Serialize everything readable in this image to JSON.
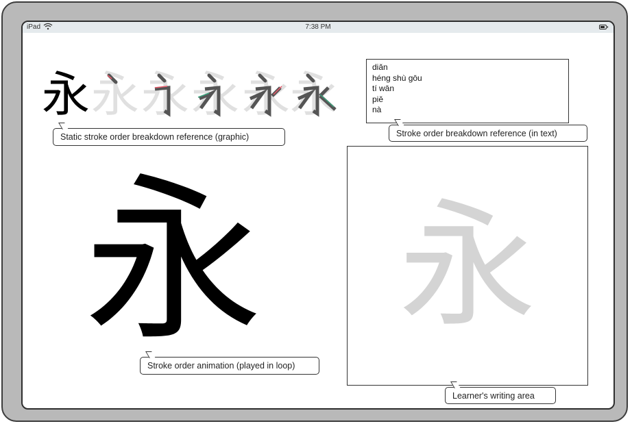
{
  "statusbar": {
    "device": "iPad",
    "time": "7:38 PM"
  },
  "character": "永",
  "stroke_strip": {
    "frames": [
      "永",
      "永",
      "永",
      "永",
      "永",
      "永"
    ]
  },
  "callouts": {
    "graphic": "Static stroke order breakdown reference (graphic)",
    "text": "Stroke order breakdown reference (in text)",
    "animation": "Stroke order animation (played in loop)",
    "writing": "Learner's writing area"
  },
  "stroke_names": [
    "diǎn",
    "héng shù gōu",
    "tí wān",
    "piě",
    "nà"
  ],
  "colors": {
    "highlight_stroke": "#e85a6a",
    "guide_glyph": "#d4d4d4"
  }
}
